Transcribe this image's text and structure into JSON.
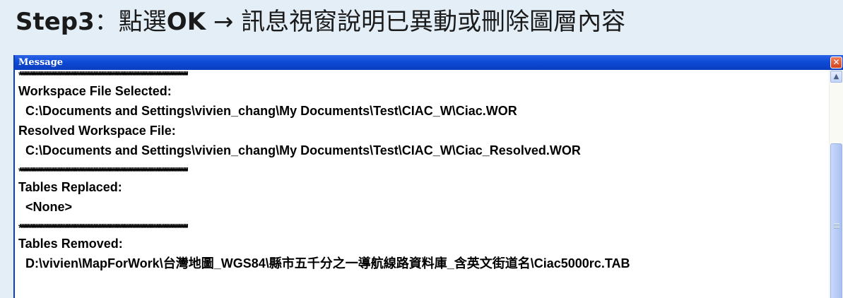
{
  "slide": {
    "title_prefix": "Step3",
    "title_colon": "：點選",
    "title_ok": "OK",
    "title_rest": " → 訊息視窗說明已異動或刪除圖層內容"
  },
  "window": {
    "title": "Message",
    "close_symbol": "✕",
    "lines": {
      "l0": "************************************************************************************************************",
      "l1": "Workspace File Selected:",
      "l2": "C:\\Documents and Settings\\vivien_chang\\My Documents\\Test\\CIAC_W\\Ciac.WOR",
      "l3": "Resolved Workspace File:",
      "l4": "C:\\Documents and Settings\\vivien_chang\\My Documents\\Test\\CIAC_W\\Ciac_Resolved.WOR",
      "l5": "************************************************************************************************************",
      "l6": "Tables Replaced:",
      "l7": "<None>",
      "l8": "************************************************************************************************************",
      "l9": "Tables Removed:",
      "l10": "D:\\vivien\\MapForWork\\台灣地圖_WGS84\\縣市五千分之一導航線路資料庫_含英文街道名\\Ciac5000rc.TAB"
    }
  },
  "scrollbar": {
    "up_symbol": "▲"
  },
  "colors": {
    "page_background": "#e3eef7",
    "titlebar": "#0a3dbf",
    "close_button": "#d2421d",
    "scroll_thumb": "#b7cbf6"
  }
}
